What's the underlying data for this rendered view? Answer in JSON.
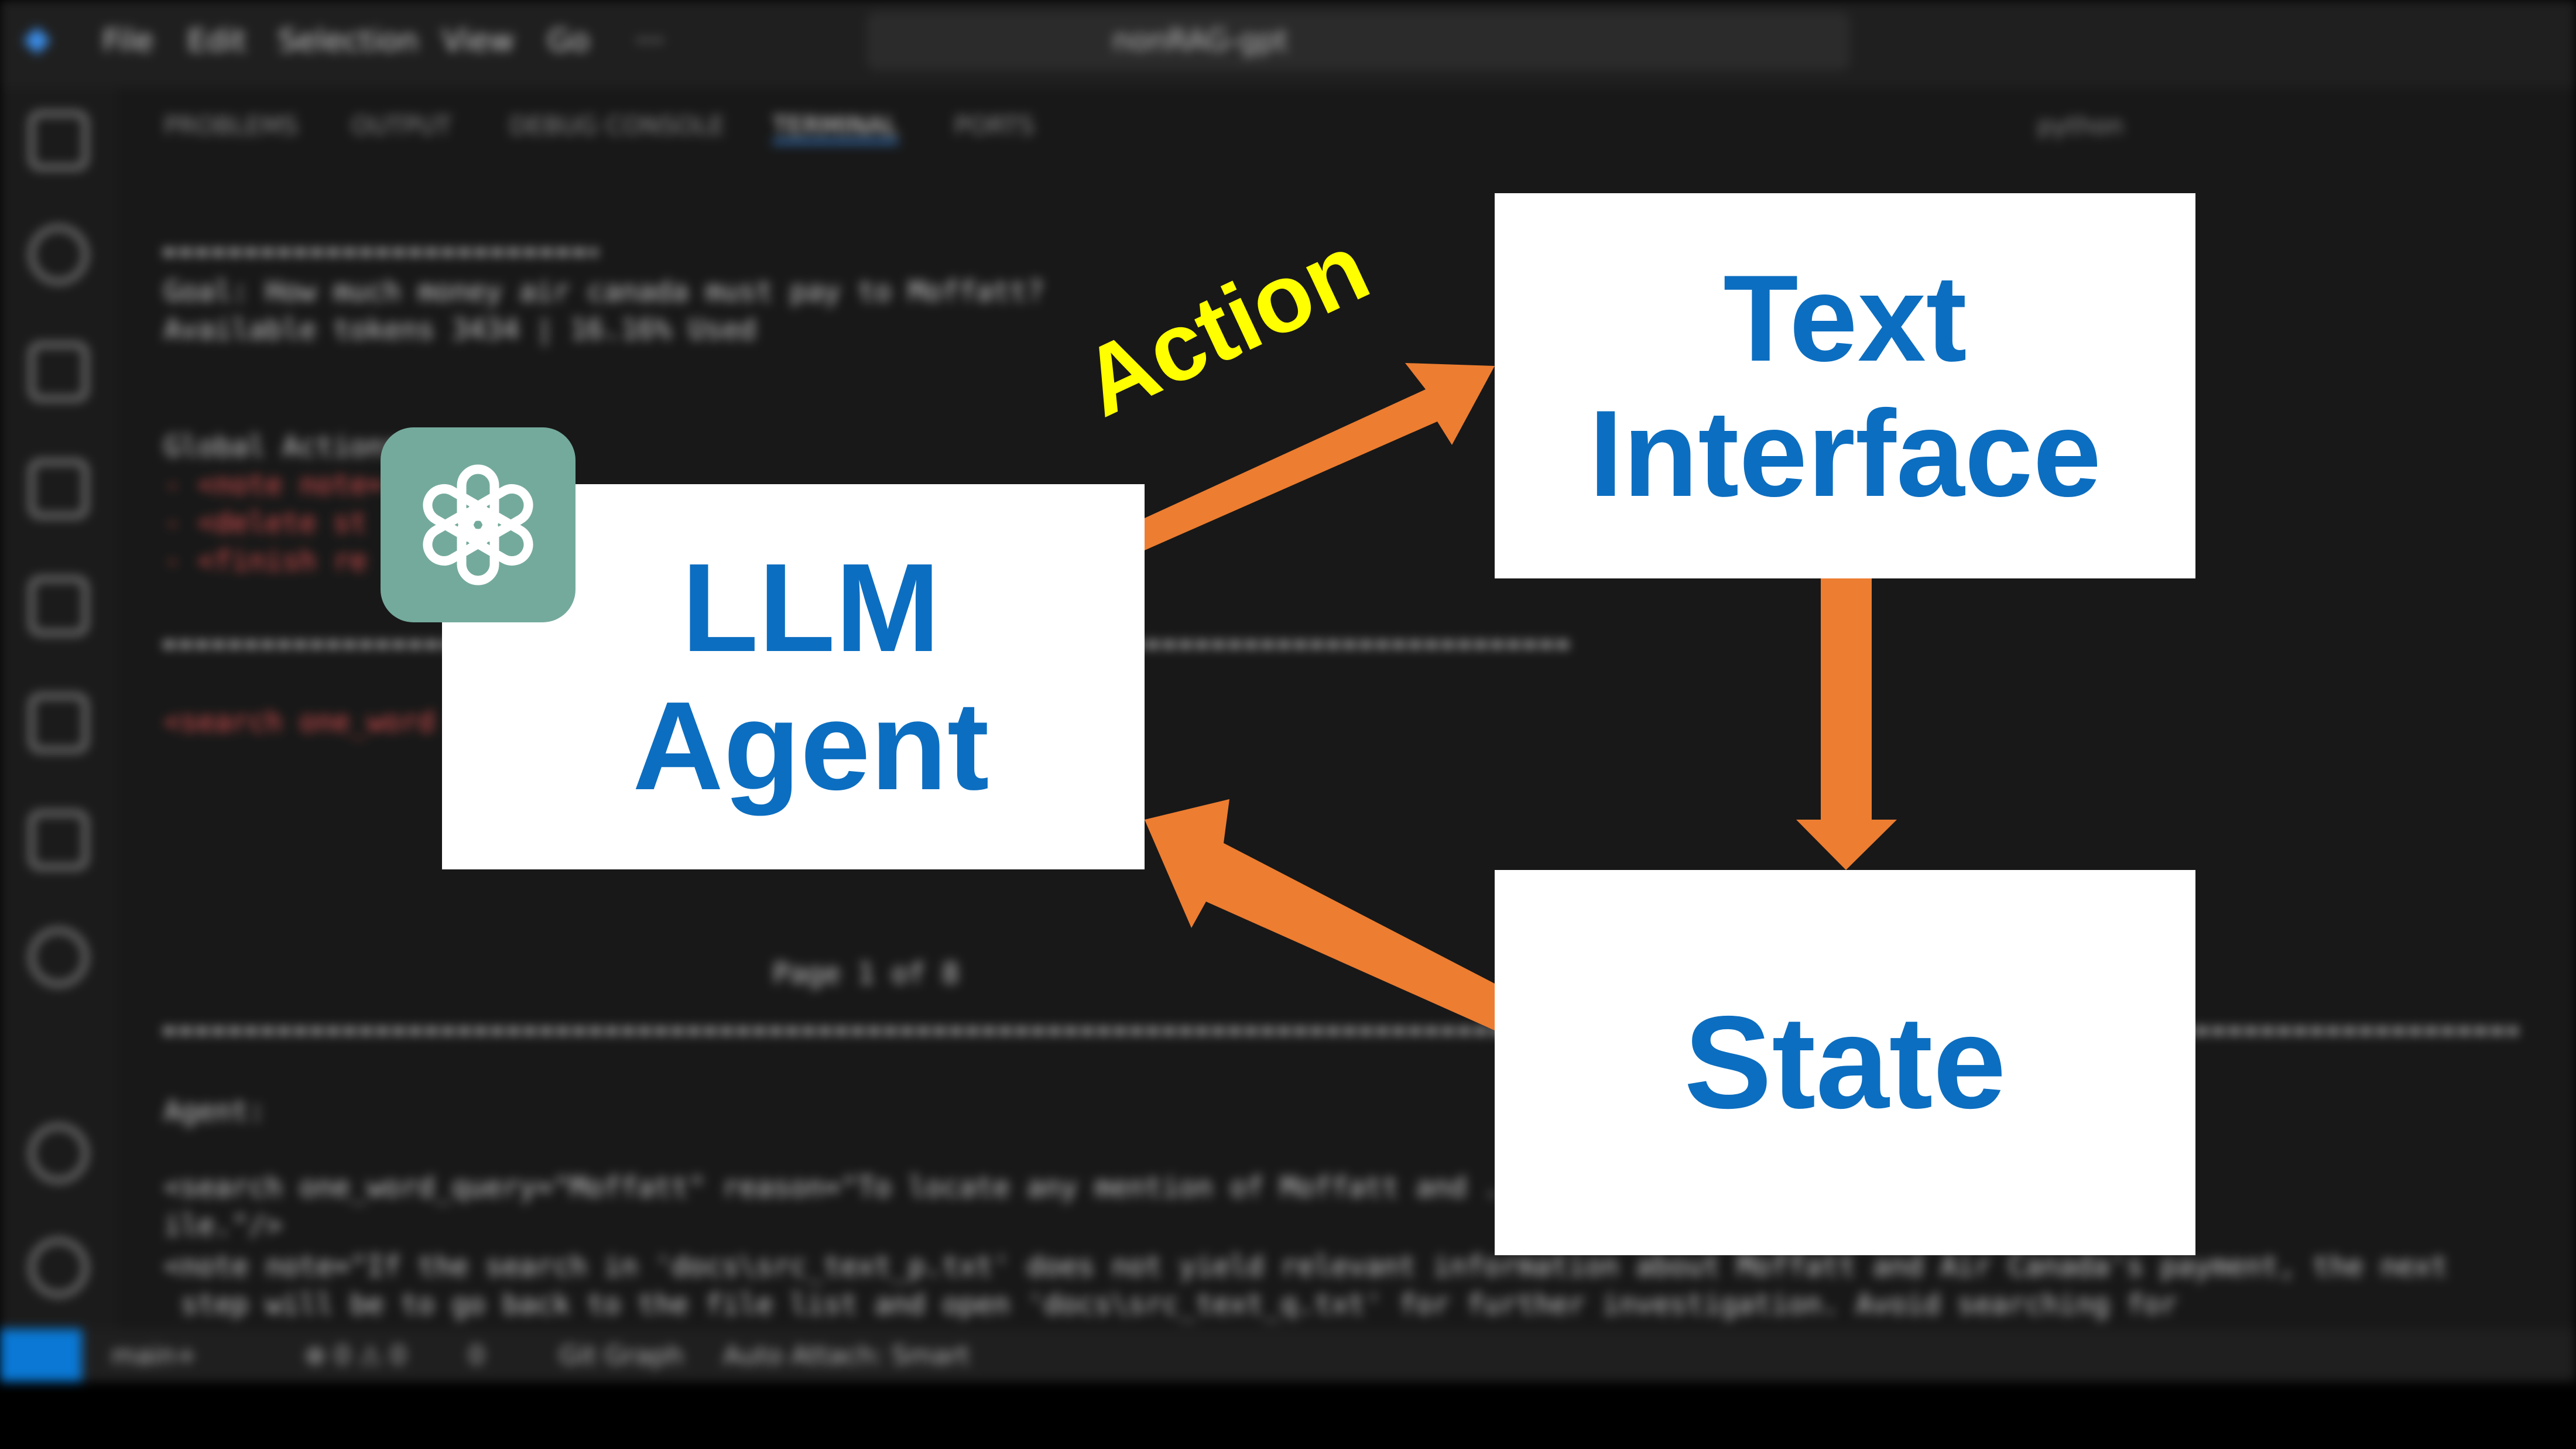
{
  "menu": [
    "File",
    "Edit",
    "Selection",
    "View",
    "Go",
    "···"
  ],
  "command_center": "nonRAG-gpt",
  "panel_tabs": [
    "PROBLEMS",
    "OUTPUT",
    "DEBUG CONSOLE",
    "TERMINAL",
    "PORTS"
  ],
  "panel_shell": "python",
  "terminal": {
    "goal": "Goal: How much money air canada must pay to Moffatt?",
    "tokens": "Available tokens 3434 | 16.16% Used",
    "global_actions": "Global Actions:",
    "agent": "Agent:",
    "line1": "<search one_word_query=\"Moffatt\" reason=\"To locate any mention of Moffatt and ... them in the current f",
    "line2": "ile.\"/>",
    "line3": "<note note=\"If the search in 'docs\\src_text_p.txt' does not yield relevant information about Moffatt and Air Canada's payment, the next",
    "line4": " step will be to go back to the file list and open 'docs\\src_text_q.txt' for further investigation. Avoid searching for",
    "page": "Page 1 of 8"
  },
  "status": {
    "branch": "main+",
    "problems": "⊗ 0 ⚠ 0",
    "ports": "0",
    "git_graph": "Git Graph",
    "auto_attach": "Auto Attach: Smart"
  },
  "diagram": {
    "agent_line1": "LLM",
    "agent_line2": "Agent",
    "interface_line1": "Text",
    "interface_line2": "Interface",
    "state": "State",
    "action": "Action"
  },
  "colors": {
    "box_text": "#0c6ec0",
    "arrow": "#ed7d31",
    "action_label": "#ffff00",
    "logo_bg": "#74aa9c"
  },
  "icons": [
    "openai-logo-icon"
  ]
}
